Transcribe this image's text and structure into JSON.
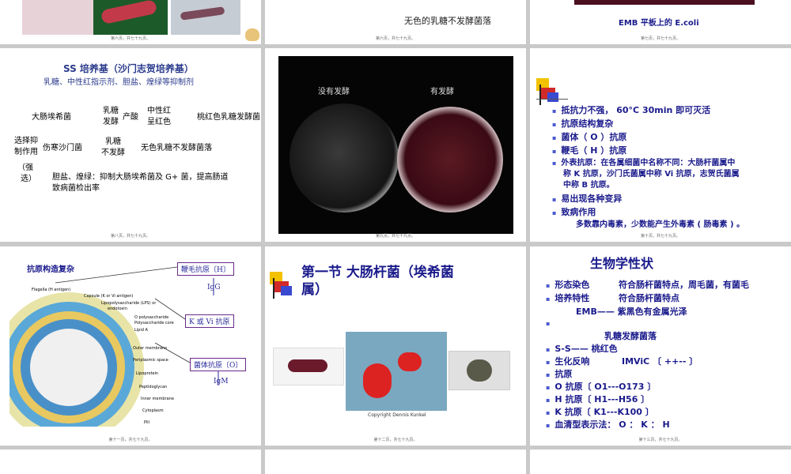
{
  "slide1": {
    "footer": "第六页，共七十九页。"
  },
  "slide2": {
    "caption": "无色的乳糖不发酵菌落",
    "footer": "第六页，共七十九页。"
  },
  "slide3": {
    "caption": "EMB 平板上的 E.coli",
    "footer": "第七页，共七十九页。"
  },
  "slide4": {
    "title": "SS 培养基（沙门志贺培养基）",
    "subtitle": "乳糖、中性红指示剂、胆盐、煌绿等抑制剂",
    "ecoli": "大肠埃希菌",
    "lactose_ferment_1": "乳糖",
    "lactose_ferment_2": "发酵",
    "acid": "产酸",
    "neutral_red_1": "中性红",
    "neutral_red_2": "呈红色",
    "pink_colony": "桃红色乳糖发酵菌",
    "selective_1": "选择抑",
    "selective_2": "制作用",
    "salmonella": "伤寒沙门菌",
    "no_ferment_1": "乳糖",
    "no_ferment_2": "不发酵",
    "colorless": "无色乳糖不发酵菌落",
    "strong_1": "（强",
    "strong_2": "选）",
    "bile_1": "胆盐、煌绿：抑制大肠埃希菌及 G+ 菌，提高肠道",
    "bile_2": "致病菌检出率",
    "footer": "第八页，共七十九页。"
  },
  "slide5": {
    "label_left": "没有发酵",
    "label_right": "有发酵",
    "footer": "第九页，共七十九页。"
  },
  "slide6": {
    "bullets": [
      "抵抗力不强， 60°C  30min  即可灭活",
      "抗原结构复杂",
      "菌体（ O ）抗原",
      "鞭毛（ H ）抗原",
      "外表抗原：在各属细菌中名称不同：大肠杆菌属中",
      "易出现各种变异",
      "致病作用"
    ],
    "bullet5_line2": "称 K 抗原，沙门氏菌属中称 Vi 抗原，志贺氏菌属",
    "bullet5_line3": "中称 B 抗原。",
    "last_line": "多数靠内毒素，少数能产生外毒素 ( 肠毒素 ) 。",
    "footer": "第十页，共七十九页。"
  },
  "slide7": {
    "title": "抗原构造复杂",
    "box_h": "鞭毛抗原〔H〕",
    "igg": "IgG",
    "box_k": "K 或 Vi 抗原",
    "box_o": "菌体抗原〔O〕",
    "igm": "IgM",
    "labels": [
      "Flagella (H antigen)",
      "Capsule (K or Vi antigen)",
      "Lipopolysaccharide (LPS) or",
      "endotoxin",
      "O polysaccharide",
      "Polysaccharide core",
      "Lipid A",
      "Outer membrane",
      "Periplasmic space",
      "Lipoprotein",
      "Peptidoglycan",
      "Inner membrane",
      "Cytoplasm",
      "Pili"
    ],
    "footer": "第十一页，共七十九页。"
  },
  "slide8": {
    "title_1": "第一节      大肠杆菌（埃希菌",
    "title_2": "属）",
    "copyright": "Copyright Dennis Kunkel",
    "footer": "第十二页，共七十九页。"
  },
  "slide9": {
    "title": "生物学性状",
    "rows": [
      {
        "k": "形态染色",
        "v": "符合肠杆菌特点，周毛菌，有菌毛"
      },
      {
        "k": "培养特性",
        "v": "符合肠杆菌特点"
      }
    ],
    "emb": "EMB—— 紫黑色有金属光泽",
    "lactose": "乳糖发酵菌落",
    "ss": "S-S—— 桃红色",
    "biochem_k": "生化反响",
    "biochem_v": "IMViC 〔 ++-- 〕",
    "antigen": "抗原",
    "o_ag": "O  抗原〔   O1---O173 〕",
    "h_ag": "H  抗原〔 H1---H56 〕",
    "k_ag": "K  抗原〔 K1---K100 〕",
    "serotype": "血清型表示法： O ： K ： H",
    "footer": "第十三页，共七十九页。"
  }
}
